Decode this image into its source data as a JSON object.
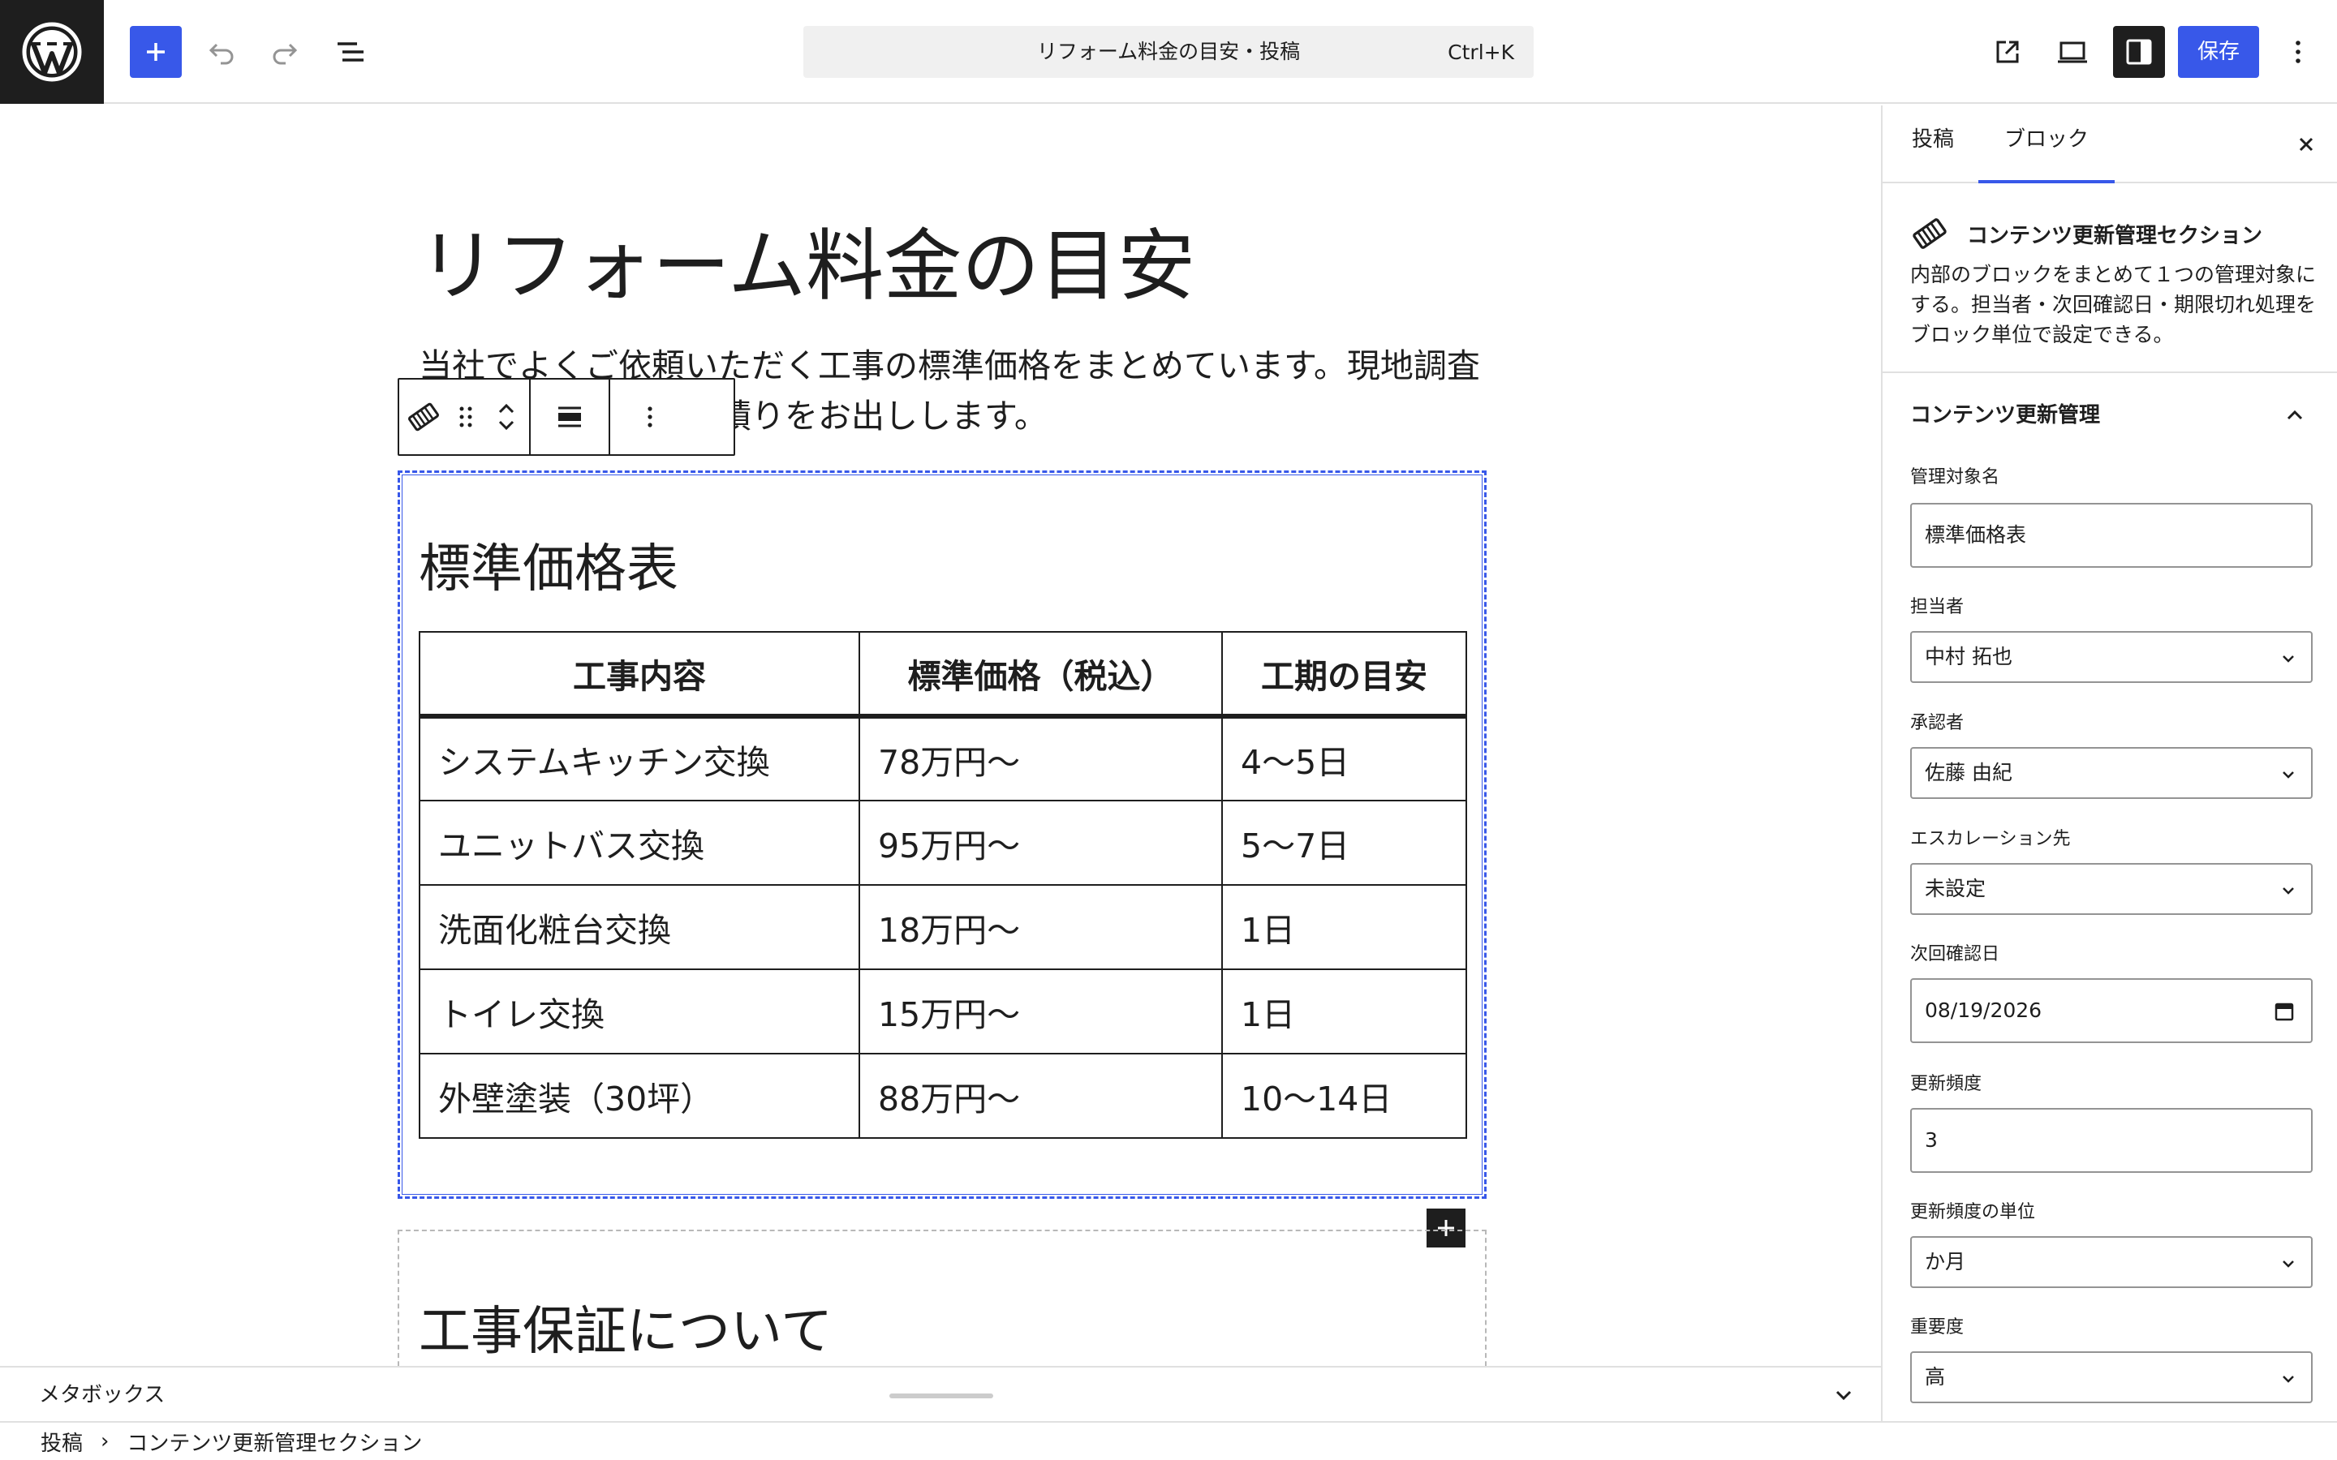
{
  "topbar": {
    "command_title": "リフォーム料金の目安・投稿",
    "command_shortcut": "Ctrl+K",
    "save_label": "保存"
  },
  "editor": {
    "post_title": "リフォーム料金の目安",
    "intro": "当社でよくご依頼いただく工事の標準価格をまとめています。現地調査のうえ、正式なお見積りをお出しします。",
    "section_heading": "標準価格表",
    "table": {
      "headers": [
        "工事内容",
        "標準価格（税込）",
        "工期の目安"
      ],
      "rows": [
        [
          "システムキッチン交換",
          "78万円〜",
          "4〜5日"
        ],
        [
          "ユニットバス交換",
          "95万円〜",
          "5〜7日"
        ],
        [
          "洗面化粧台交換",
          "18万円〜",
          "1日"
        ],
        [
          "トイレ交換",
          "15万円〜",
          "1日"
        ],
        [
          "外壁塗装（30坪）",
          "88万円〜",
          "10〜14日"
        ]
      ]
    },
    "next_heading": "工事保証について"
  },
  "metabox": {
    "label": "メタボックス"
  },
  "breadcrumb": {
    "root": "投稿",
    "current": "コンテンツ更新管理セクション"
  },
  "sidebar": {
    "tab_post": "投稿",
    "tab_block": "ブロック",
    "block_name": "コンテンツ更新管理セクション",
    "block_description": "内部のブロックをまとめて１つの管理対象にする。担当者・次回確認日・期限切れ処理をブロック単位で設定できる。",
    "panel_title": "コンテンツ更新管理",
    "fields": {
      "target_name_label": "管理対象名",
      "target_name_value": "標準価格表",
      "owner_label": "担当者",
      "owner_value": "中村 拓也",
      "approver_label": "承認者",
      "approver_value": "佐藤 由紀",
      "escalation_label": "エスカレーション先",
      "escalation_value": "未設定",
      "next_check_label": "次回確認日",
      "next_check_value": "08/19/2026",
      "frequency_label": "更新頻度",
      "frequency_value": "3",
      "frequency_unit_label": "更新頻度の単位",
      "frequency_unit_value": "か月",
      "priority_label": "重要度",
      "priority_value": "高"
    }
  },
  "colors": {
    "accent": "#3858e9",
    "dark": "#1e1e1e",
    "border": "#e0e0e0"
  }
}
